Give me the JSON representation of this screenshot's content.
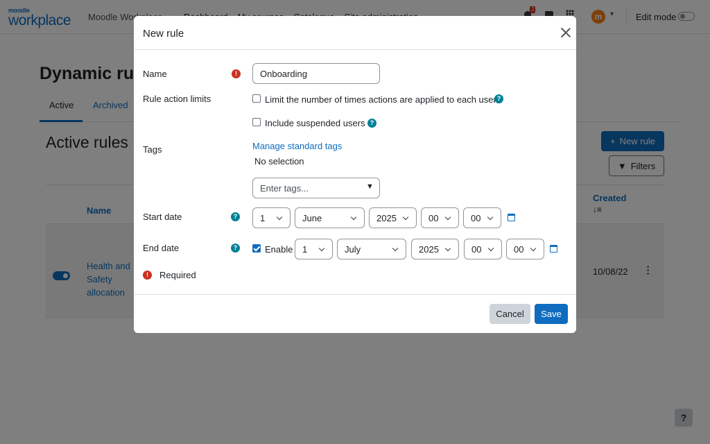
{
  "brand": {
    "logo_top": "moodle",
    "logo_bottom": "workplace",
    "site_name": "Moodle Workplace"
  },
  "nav": {
    "links": [
      "Dashboard",
      "My courses",
      "Catalogue",
      "Site administration"
    ],
    "notification_count": "2",
    "avatar_letter": "m",
    "edit_mode_label": "Edit mode"
  },
  "page": {
    "title": "Dynamic rules",
    "tabs": {
      "active": "Active",
      "archived": "Archived"
    },
    "section_title": "Active rules",
    "new_rule_button": "New rule",
    "filters_button": "Filters",
    "table": {
      "col_name": "Name",
      "col_created": "Created",
      "sort_indicator": "↓≡",
      "row": {
        "name": "Health and Safety allocation",
        "created": "10/08/22"
      }
    },
    "help_button": "?"
  },
  "modal": {
    "title": "New rule",
    "name_label": "Name",
    "name_value": "Onboarding",
    "rule_action_limits_label": "Rule action limits",
    "limit_checkbox_label": "Limit the number of times actions are applied to each user",
    "suspended_checkbox_label": "Include suspended users",
    "tags_label": "Tags",
    "manage_tags_link": "Manage standard tags",
    "no_selection": "No selection",
    "tags_placeholder": "Enter tags...",
    "start_date_label": "Start date",
    "start_date": {
      "day": "1",
      "month": "June",
      "year": "2025",
      "hour": "00",
      "minute": "00"
    },
    "end_date_label": "End date",
    "end_enable_label": "Enable",
    "end_date": {
      "day": "1",
      "month": "July",
      "year": "2025",
      "hour": "00",
      "minute": "00"
    },
    "required_label": "Required",
    "cancel_button": "Cancel",
    "save_button": "Save"
  },
  "colors": {
    "primary": "#0f6cbf",
    "required": "#ca3120",
    "help": "#008196"
  }
}
